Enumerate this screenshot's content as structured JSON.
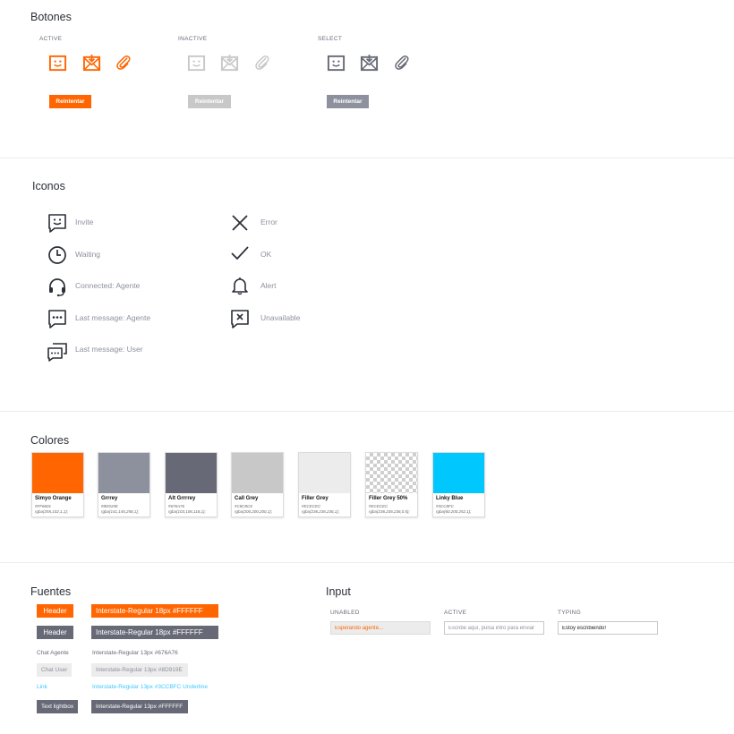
{
  "colors": {
    "orange": "#FF6601",
    "grey": "#8D919E",
    "alt_grey": "#676A76",
    "call_grey": "#C8C8C8",
    "filler_grey": "#ECECEC",
    "linky_blue": "#3CC8FC"
  },
  "botones": {
    "title": "Botones",
    "groups": [
      {
        "label": "ACTIVE",
        "icons": [
          "invite-icon",
          "mail-icon",
          "clip-icon"
        ],
        "button": "Reintentar"
      },
      {
        "label": "INACTIVE",
        "icons": [
          "invite-icon",
          "mail-icon",
          "clip-icon"
        ],
        "button": "Reintentar"
      },
      {
        "label": "SELECT",
        "icons": [
          "invite-icon",
          "mail-icon",
          "clip-icon"
        ],
        "button": "Reintentar"
      }
    ]
  },
  "iconos": {
    "title": "Iconos",
    "left": [
      {
        "icon": "invite-icon",
        "label": "Invite"
      },
      {
        "icon": "clock-icon",
        "label": "Waiting"
      },
      {
        "icon": "headset-icon",
        "label": "Connected: Agente"
      },
      {
        "icon": "chat-dots-icon",
        "label": "Last message: Agente"
      },
      {
        "icon": "chat-bubbles-icon",
        "label": "Last message: User"
      }
    ],
    "right": [
      {
        "icon": "close-icon",
        "label": "Error"
      },
      {
        "icon": "check-icon",
        "label": "OK"
      },
      {
        "icon": "bell-icon",
        "label": "Alert"
      },
      {
        "icon": "unavailable-icon",
        "label": "Unavailable"
      }
    ]
  },
  "colores": {
    "title": "Colores",
    "swatches": [
      {
        "name": "Simyo Orange",
        "hex": "#FF6601",
        "rgba": "rgba(255,102,1,1);",
        "color": "#FF6601"
      },
      {
        "name": "Grrrey",
        "hex": "#8D919E",
        "rgba": "rgba(141,145,258,1);",
        "color": "#8D919E"
      },
      {
        "name": "Alt Grrrrey",
        "hex": "#676A76",
        "rgba": "rgba(103,106,118,1);",
        "color": "#676A76"
      },
      {
        "name": "Call Grey",
        "hex": "#C8C8C8",
        "rgba": "rgba(200,200,200,1);",
        "color": "#C8C8C8"
      },
      {
        "name": "Filler Grey",
        "hex": "#ECECEC",
        "rgba": "rgba(236,236,236,1);",
        "color": "#ECECEC"
      },
      {
        "name": "Filler Grey 50%",
        "hex": "#ECECEC",
        "rgba": "rgba(236,236,236,0.5);",
        "color": "checker"
      },
      {
        "name": "Linky Blue",
        "hex": "#3CC8FC",
        "rgba": "rgba(60,200,252,1);",
        "color": "#00C8FF"
      }
    ]
  },
  "fuentes": {
    "title": "Fuentes",
    "rows": [
      {
        "sample": "Header",
        "spec": "Interstate-Regular 18px #FFFFFF"
      },
      {
        "sample": "Header",
        "spec": "Interstate-Regular 18px #FFFFFF"
      },
      {
        "sample": "Chat Agente",
        "spec": "Interstate-Regular 13px #676A76"
      },
      {
        "sample": "Chat User",
        "spec": "Interstate-Regular 13px #8D919E"
      },
      {
        "sample": "Link",
        "spec": "Interstate-Regular 13px #3CCBFC Underline"
      },
      {
        "sample": "Text lightbox",
        "spec": "Interstate-Regular 13px #FFFFFF"
      }
    ]
  },
  "input": {
    "title": "Input",
    "fields": [
      {
        "label": "UNABLED",
        "value": "Esperando agente...",
        "placeholder": ""
      },
      {
        "label": "ACTIVE",
        "value": "",
        "placeholder": "Escribe aquí, pulsa intro para enviar"
      },
      {
        "label": "TYPING",
        "value": "Estoy escribiendo!",
        "placeholder": ""
      }
    ]
  }
}
